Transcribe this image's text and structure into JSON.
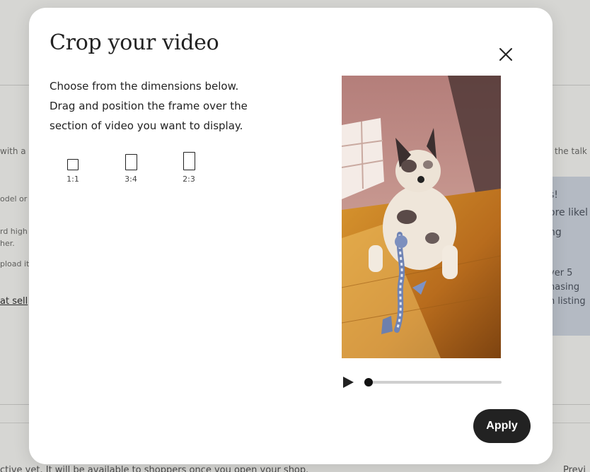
{
  "background": {
    "fragments": [
      "with a",
      "the talk",
      "odel or",
      "rd high",
      "her.",
      "pload it",
      "at sell",
      "ctive yet. It will be available to shoppers once you open your shop.",
      "Previ"
    ],
    "card_fragments": [
      "s!",
      "ore likel",
      "ng",
      "ver 5",
      "hasing",
      "n listing"
    ]
  },
  "modal": {
    "title": "Crop your video",
    "instructions": [
      "Choose from the dimensions below.",
      "Drag and position the frame over the",
      "section of video you want to display."
    ],
    "aspect_ratios": [
      {
        "label": "1:1",
        "w": 1,
        "h": 1
      },
      {
        "label": "3:4",
        "w": 3,
        "h": 4
      },
      {
        "label": "2:3",
        "w": 2,
        "h": 3
      }
    ],
    "close_icon": "close-icon",
    "play_icon": "play-icon",
    "playback_progress": 0.0,
    "apply_label": "Apply"
  },
  "colors": {
    "primary_button": "#222222",
    "track": "#cfcfcf"
  }
}
